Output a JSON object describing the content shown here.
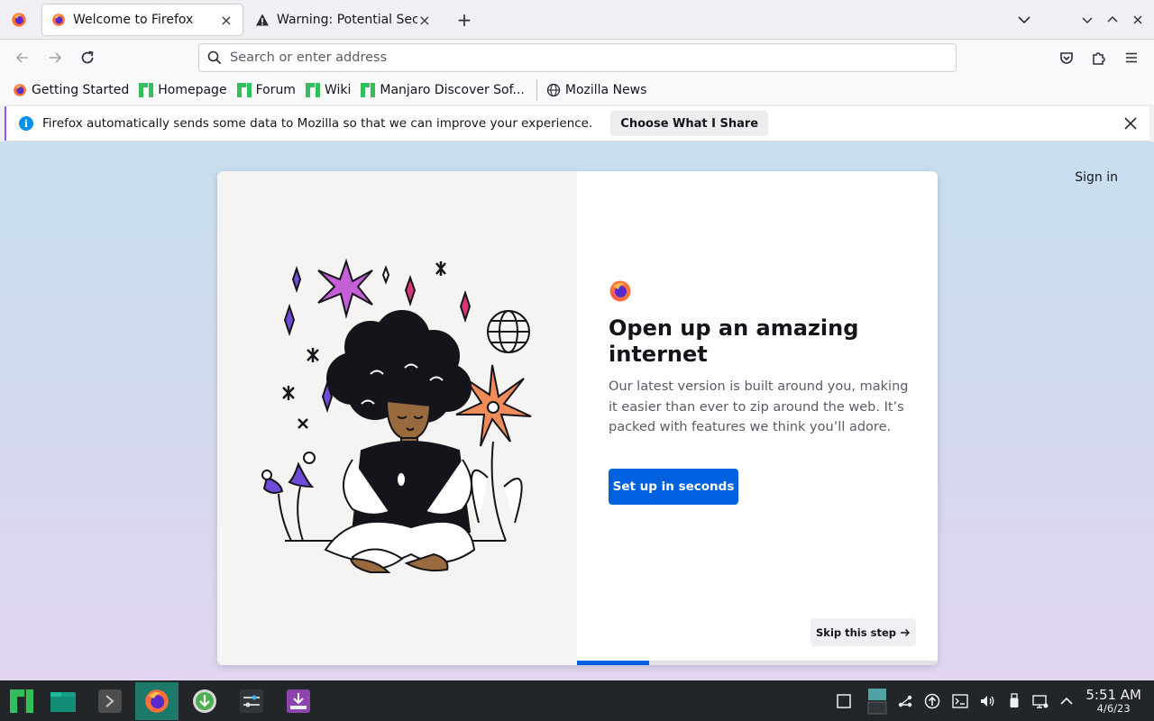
{
  "tabs": [
    {
      "label": "Welcome to Firefox",
      "icon": "firefox-icon",
      "active": true
    },
    {
      "label": "Warning: Potential Security Risk Ahead",
      "icon": "warning-icon",
      "active": false
    }
  ],
  "urlbar": {
    "placeholder": "Search or enter address"
  },
  "bookmarks": [
    {
      "label": "Getting Started",
      "icon": "firefox-icon"
    },
    {
      "label": "Homepage",
      "icon": "manjaro-icon"
    },
    {
      "label": "Forum",
      "icon": "manjaro-icon"
    },
    {
      "label": "Wiki",
      "icon": "manjaro-icon"
    },
    {
      "label": "Manjaro Discover Sof...",
      "icon": "manjaro-icon"
    },
    {
      "label": "Mozilla News",
      "icon": "globe-icon"
    }
  ],
  "notification": {
    "text": "Firefox automatically sends some data to Mozilla so that we can improve your experience.",
    "button": "Choose What I Share"
  },
  "page": {
    "signin": "Sign in",
    "heading": "Open up an amazing internet",
    "description": "Our latest version is built around you, making it easier than ever to zip around the web. It’s packed with features we think you’ll adore.",
    "primary_button": "Set up in seconds",
    "skip_button": "Skip this step",
    "progress_fraction": 0.2
  },
  "taskbar": {
    "apps": [
      "manjaro-menu-icon",
      "file-manager-icon",
      "terminal-icon",
      "firefox-icon",
      "downloader-icon",
      "system-settings-icon",
      "installer-icon"
    ],
    "tray": [
      "show-desktop-icon",
      "pager-icon",
      "network-share-icon",
      "updates-icon",
      "console-icon",
      "volume-icon",
      "usb-icon",
      "network-icon",
      "expand-tray-icon"
    ],
    "time": "5:51 AM",
    "date": "4/6/23"
  },
  "colors": {
    "accent": "#0061e0",
    "notice_bar": "#9059ff",
    "taskbar": "#232629"
  }
}
